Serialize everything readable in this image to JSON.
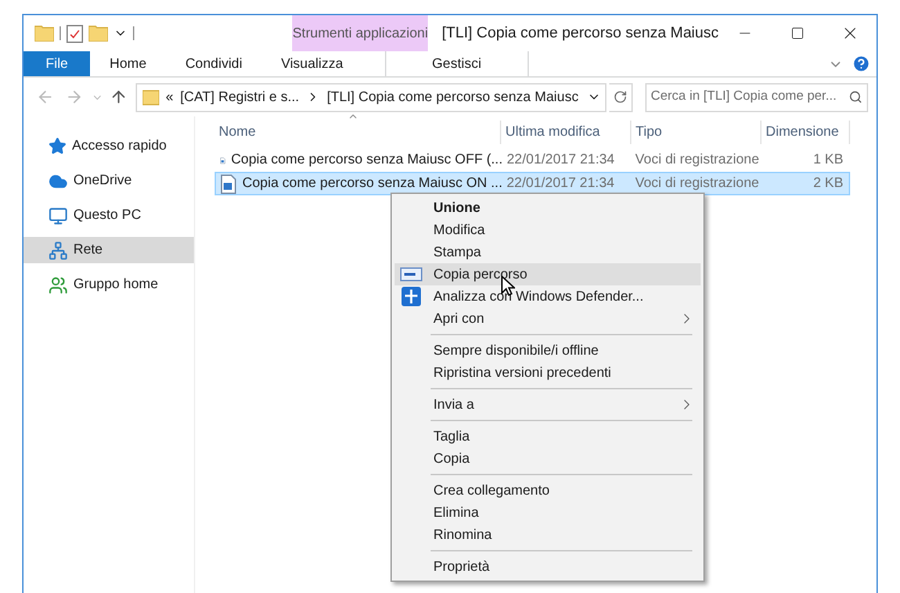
{
  "window": {
    "title": "[TLI] Copia come percorso senza Maiusc"
  },
  "contextual_group": {
    "label": "Strumenti applicazioni"
  },
  "ribbon_tabs": [
    {
      "label": "File",
      "kind": "file",
      "selected": false
    },
    {
      "label": "Home",
      "kind": "tab",
      "selected": false
    },
    {
      "label": "Condividi",
      "kind": "tab",
      "selected": false
    },
    {
      "label": "Visualizza",
      "kind": "tab",
      "selected": false
    },
    {
      "label": "Gestisci",
      "kind": "contextual",
      "selected": false
    }
  ],
  "address_bar": {
    "overflow": "«",
    "crumbs": [
      "[CAT] Registri e s...",
      "[TLI] Copia come percorso senza Maiusc"
    ]
  },
  "search": {
    "placeholder": "Cerca in [TLI] Copia come per..."
  },
  "sidebar": {
    "items": [
      {
        "label": "Accesso rapido",
        "selected": false
      },
      {
        "label": "OneDrive",
        "selected": false
      },
      {
        "label": "Questo PC",
        "selected": false
      },
      {
        "label": "Rete",
        "selected": true
      },
      {
        "label": "Gruppo home",
        "selected": false
      }
    ]
  },
  "table": {
    "columns": [
      "Nome",
      "Ultima modifica",
      "Tipo",
      "Dimensione"
    ],
    "rows": [
      {
        "name": "Copia come percorso senza Maiusc OFF (...",
        "modified": "22/01/2017 21:34",
        "type": "Voci di registrazione",
        "size": "1 KB",
        "selected": false
      },
      {
        "name": "Copia come percorso senza Maiusc ON ...",
        "modified": "22/01/2017 21:34",
        "type": "Voci di registrazione",
        "size": "2 KB",
        "selected": true
      }
    ]
  },
  "context_menu": {
    "items": [
      {
        "kind": "item",
        "label": "Unione",
        "bold": true,
        "highlighted": false,
        "submenu": false
      },
      {
        "kind": "item",
        "label": "Modifica",
        "bold": false,
        "highlighted": false,
        "submenu": false
      },
      {
        "kind": "item",
        "label": "Stampa",
        "bold": false,
        "highlighted": false,
        "submenu": false
      },
      {
        "kind": "pathitem",
        "label": "Copia percorso",
        "bold": false,
        "highlighted": true,
        "submenu": false
      },
      {
        "kind": "shielditem",
        "label": "Analizza con Windows Defender...",
        "bold": false,
        "highlighted": false,
        "submenu": false
      },
      {
        "kind": "item",
        "label": "Apri con",
        "bold": false,
        "highlighted": false,
        "submenu": true
      },
      {
        "kind": "separator"
      },
      {
        "kind": "item",
        "label": "Sempre disponibile/i offline",
        "bold": false,
        "highlighted": false,
        "submenu": false
      },
      {
        "kind": "item",
        "label": "Ripristina versioni precedenti",
        "bold": false,
        "highlighted": false,
        "submenu": false
      },
      {
        "kind": "separator"
      },
      {
        "kind": "item",
        "label": "Invia a",
        "bold": false,
        "highlighted": false,
        "submenu": true
      },
      {
        "kind": "separator"
      },
      {
        "kind": "item",
        "label": "Taglia",
        "bold": false,
        "highlighted": false,
        "submenu": false
      },
      {
        "kind": "item",
        "label": "Copia",
        "bold": false,
        "highlighted": false,
        "submenu": false
      },
      {
        "kind": "separator"
      },
      {
        "kind": "item",
        "label": "Crea collegamento",
        "bold": false,
        "highlighted": false,
        "submenu": false
      },
      {
        "kind": "item",
        "label": "Elimina",
        "bold": false,
        "highlighted": false,
        "submenu": false
      },
      {
        "kind": "item",
        "label": "Rinomina",
        "bold": false,
        "highlighted": false,
        "submenu": false
      },
      {
        "kind": "separator"
      },
      {
        "kind": "item",
        "label": "Proprietà",
        "bold": false,
        "highlighted": false,
        "submenu": false
      }
    ]
  }
}
